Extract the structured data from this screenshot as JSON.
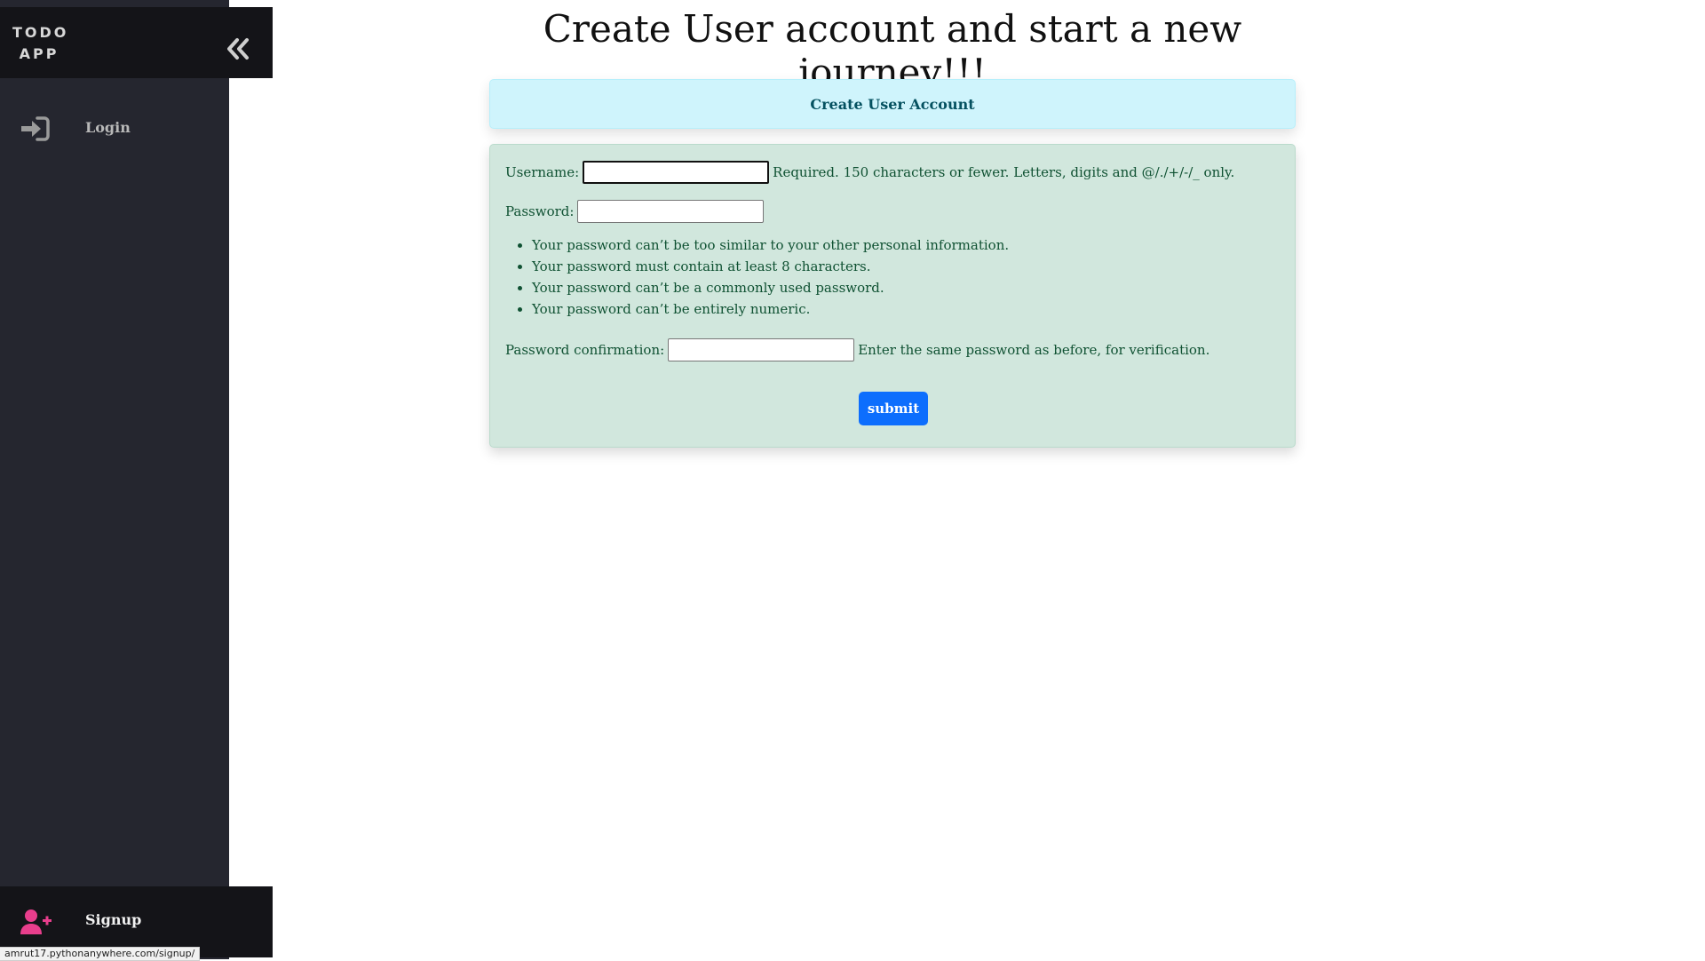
{
  "sidebar": {
    "brand": "TODO APP",
    "nav": {
      "login_label": "Login"
    },
    "signup_label": "Signup"
  },
  "status_bar": {
    "url": "amrut17.pythonanywhere.com/signup/"
  },
  "main": {
    "title": "Create User account and start a new journey!!!",
    "card_header": "Create User Account",
    "form": {
      "username_label": "Username:",
      "username_value": "",
      "username_help": "Required. 150 characters or fewer. Letters, digits and @/./+/-/_ only.",
      "password_label": "Password:",
      "password_value": "",
      "password_rules": [
        "Your password can’t be too similar to your other personal information.",
        "Your password must contain at least 8 characters.",
        "Your password can’t be a commonly used password.",
        "Your password can’t be entirely numeric."
      ],
      "confirm_label": "Password confirmation:",
      "confirm_value": "",
      "confirm_help": "Enter the same password as before, for verification.",
      "submit_label": "submit"
    }
  },
  "colors": {
    "sidebar_bg": "#25262f",
    "brand_bg": "#141418",
    "signup_icon": "#e83e8c",
    "header_bg": "#cff4fc",
    "body_bg": "#d1e7dd",
    "primary": "#0d6efd"
  },
  "icons": {
    "collapse": "double-chevron-left-icon",
    "login": "sign-in-icon",
    "signup": "user-plus-icon"
  }
}
